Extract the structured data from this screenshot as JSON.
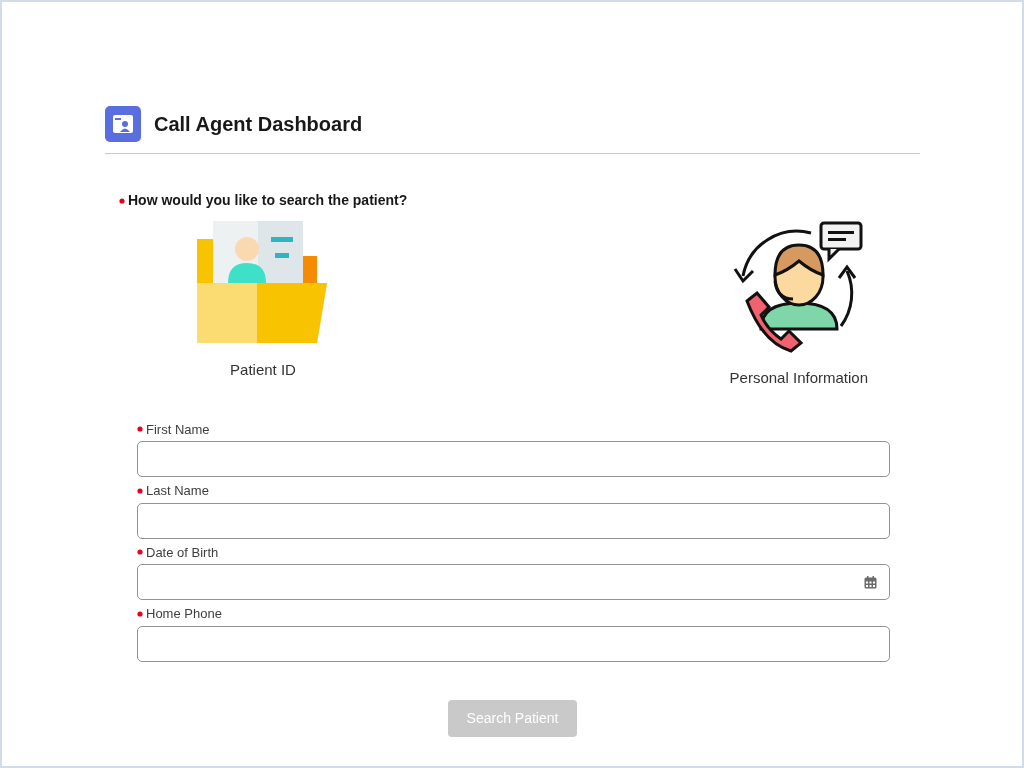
{
  "header": {
    "title": "Call Agent Dashboard"
  },
  "search_method": {
    "question": "How would you like to search the patient?",
    "required": true,
    "options": [
      {
        "label": "Patient ID",
        "kind": "folder",
        "selected": false
      },
      {
        "label": "Personal Information",
        "kind": "agent",
        "selected": false
      }
    ]
  },
  "fields": [
    {
      "label": "First Name",
      "required": true,
      "kind": "text"
    },
    {
      "label": "Last Name",
      "required": true,
      "kind": "text"
    },
    {
      "label": "Date of Birth",
      "required": true,
      "kind": "date"
    },
    {
      "label": "Home Phone",
      "required": true,
      "kind": "text"
    }
  ],
  "submit_button": {
    "label": "Search Patient",
    "disabled": true
  }
}
